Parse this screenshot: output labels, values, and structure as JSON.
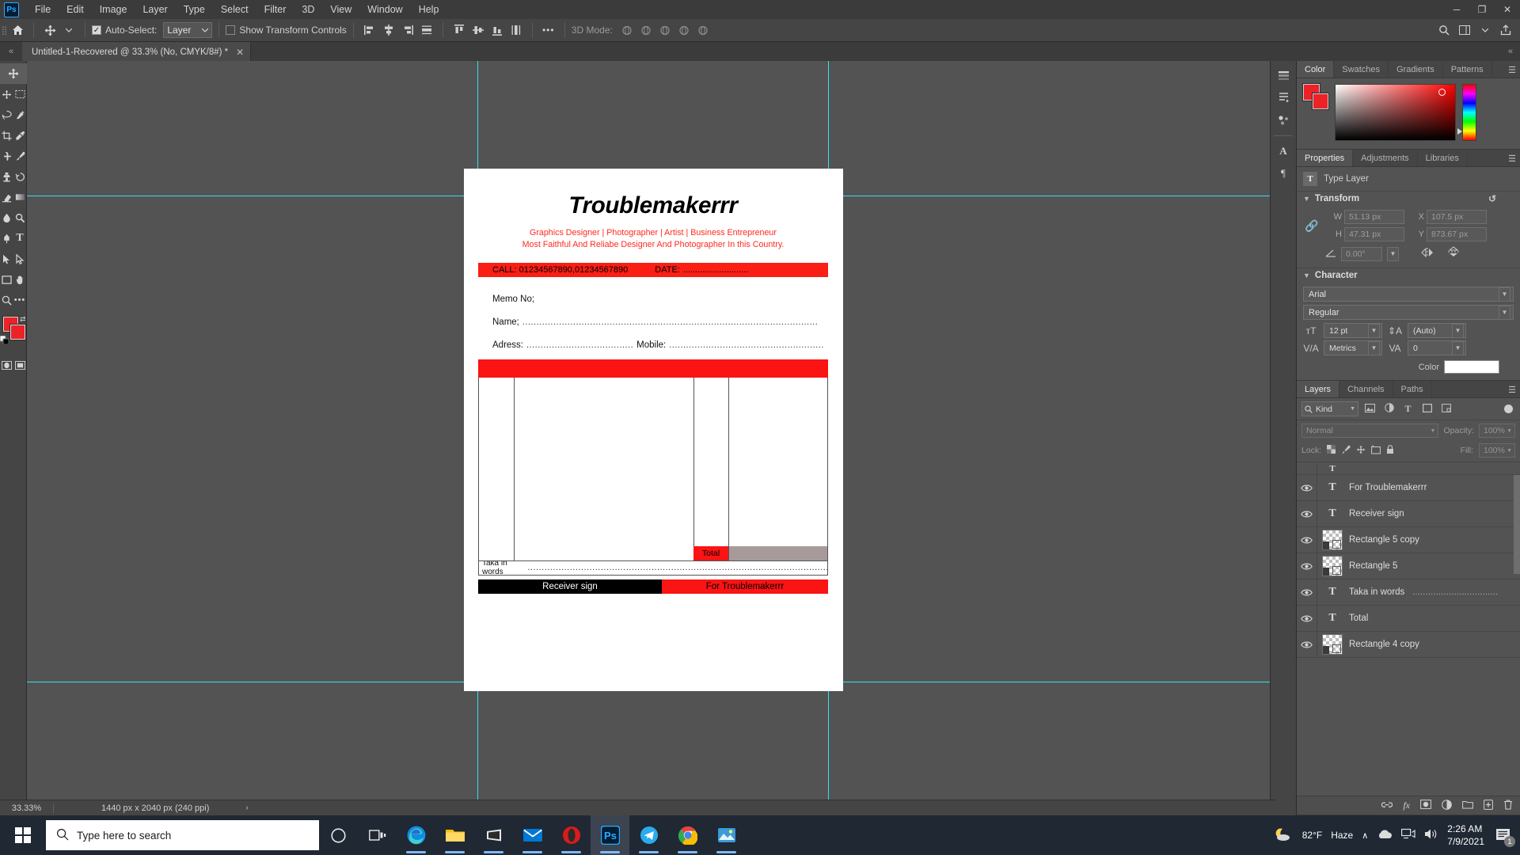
{
  "app": {
    "name": "Adobe Photoshop",
    "logo_text": "Ps"
  },
  "menubar": {
    "items": [
      "File",
      "Edit",
      "Image",
      "Layer",
      "Type",
      "Select",
      "Filter",
      "3D",
      "View",
      "Window",
      "Help"
    ],
    "window_controls": {
      "minimize": "─",
      "maximize": "❐",
      "close": "✕"
    }
  },
  "options_bar": {
    "home_icon": "home-icon",
    "move_tool_icon": "move-tool-icon",
    "auto_select_label": "Auto-Select:",
    "auto_select_checked": true,
    "layer_select_value": "Layer",
    "show_transform_label": "Show Transform Controls",
    "show_transform_checked": false,
    "more_label": "•••",
    "mode_3d_label": "3D Mode:",
    "align_icons": [
      "align-left-edges-icon",
      "align-horizontal-centers-icon",
      "align-right-edges-icon",
      "distribute-horizontally-icon",
      "align-top-edges-icon",
      "align-vertical-centers-icon",
      "align-bottom-edges-icon",
      "distribute-vertically-icon"
    ],
    "mode3d_icons": [
      "orbit-3d-icon",
      "roll-3d-icon",
      "pan-3d-icon",
      "slide-3d-icon",
      "scale-3d-icon"
    ],
    "right_icons": [
      "search-icon",
      "workspace-icon",
      "arrange-documents-icon",
      "share-icon"
    ]
  },
  "document_tab": {
    "title": "Untitled-1-Recovered @ 33.3% (No, CMYK/8#) *",
    "close": "✕",
    "dock_collapse": "«",
    "right_collapse": "«"
  },
  "toolbar": {
    "tools": [
      "move-tool",
      "rectangular-marquee-tool",
      "lasso-tool",
      "quick-selection-tool",
      "crop-tool",
      "eyedropper-tool",
      "spot-healing-brush-tool",
      "brush-tool",
      "clone-stamp-tool",
      "history-brush-tool",
      "eraser-tool",
      "gradient-tool",
      "blur-tool",
      "dodge-tool",
      "pen-tool",
      "type-tool",
      "path-selection-tool",
      "rectangle-tool",
      "hand-tool",
      "zoom-tool",
      "more-tools",
      "edit-toolbar",
      "quick-mask-tool",
      "screen-mode-tool"
    ],
    "foreground_color": "#ec2227",
    "background_color": "#ec2227",
    "swap_icon": "swap-colors-icon",
    "default_icon": "default-colors-icon"
  },
  "canvas": {
    "background": "#535353",
    "guides_color": "#32e0e8",
    "document": {
      "title": "Troublemakerrr",
      "subtitle_line1": "Graphics Designer | Photographer | Artist | Business Entrepreneur",
      "subtitle_line2": "Most Faithful And Reliabe Designer And Photographer In this Country.",
      "subtitle_color": "#ff2a1f",
      "call_bar": {
        "call_text": "CALL: 01234567890,01234567890",
        "date_label": "DATE:",
        "date_dots": "...........................",
        "background": "#fa1e14"
      },
      "memo_label": "Memo No;",
      "fields": [
        {
          "label": "Name;",
          "dots": "........................................................................................................."
        },
        {
          "label": "Adress:",
          "dots": "......................................",
          "label2": "Mobile:",
          "dots2": "......................................................."
        }
      ],
      "red_band_color": "#fa1414",
      "table": {
        "total_label": "Total",
        "total_cell_color": "#fa1414",
        "amount_cell_color": "#a69a9a"
      },
      "taka_label": "Taka in words",
      "taka_dots": "..........................................................................................................................",
      "footer": {
        "receiver_sign": "Receiver sign",
        "for_company": "For Troublemakerrr",
        "left_background": "#000000",
        "right_background": "#fa1414"
      }
    }
  },
  "right_iconbar": {
    "items": [
      "history-panel-icon",
      "actions-panel-icon",
      "brush-settings-icon",
      "adjustments-panel-icon",
      "character-panel-icon",
      "paragraph-panel-icon"
    ]
  },
  "color_panel": {
    "tabs": [
      "Color",
      "Swatches",
      "Gradients",
      "Patterns"
    ],
    "active_tab": "Color",
    "menu_icon": "panel-menu-icon",
    "foreground": "#ec2227",
    "background": "#ec2227"
  },
  "properties_panel": {
    "tabs": [
      "Properties",
      "Adjustments",
      "Libraries"
    ],
    "active_tab": "Properties",
    "menu_icon": "panel-menu-icon",
    "layer_type": "Type Layer",
    "transform": {
      "section_title": "Transform",
      "reset_icon": "reset-icon",
      "link_icon": "link-icon",
      "w_label": "W",
      "w_value": "51.13 px",
      "h_label": "H",
      "h_value": "47.31 px",
      "x_label": "X",
      "x_value": "107.5 px",
      "y_label": "Y",
      "y_value": "873.67 px",
      "angle_icon": "angle-icon",
      "angle_value": "0.00°",
      "flip_h_icon": "flip-horizontal-icon",
      "flip_v_icon": "flip-vertical-icon"
    },
    "character": {
      "section_title": "Character",
      "font_family": "Arial",
      "font_style": "Regular",
      "size_icon": "font-size-icon",
      "font_size": "12 pt",
      "leading_icon": "leading-icon",
      "leading": "(Auto)",
      "kerning_icon": "kerning-icon",
      "kerning": "Metrics",
      "tracking_icon": "tracking-icon",
      "tracking": "0",
      "color_label": "Color",
      "color_value": "#ffffff"
    }
  },
  "layers_panel": {
    "tabs": [
      "Layers",
      "Channels",
      "Paths"
    ],
    "active_tab": "Layers",
    "menu_icon": "panel-menu-icon",
    "filter": {
      "search_icon": "search-icon",
      "kind_label": "Kind",
      "icons": [
        "filter-pixel-icon",
        "filter-adjustment-icon",
        "filter-type-icon",
        "filter-shape-icon",
        "filter-smart-object-icon"
      ],
      "toggle": "filter-toggle"
    },
    "blend_mode": "Normal",
    "opacity_label": "Opacity:",
    "opacity_value": "100%",
    "fill_label": "Fill:",
    "fill_value": "100%",
    "lock_label": "Lock:",
    "lock_icons": [
      "lock-transparent-pixels-icon",
      "lock-image-pixels-icon",
      "lock-position-icon",
      "lock-artboard-icon",
      "lock-all-icon"
    ],
    "layers": [
      {
        "name": "For Troublemakerrr",
        "type": "type",
        "visible": true
      },
      {
        "name": "Receiver sign",
        "type": "type",
        "visible": true
      },
      {
        "name": "Rectangle 5 copy",
        "type": "shape",
        "visible": true
      },
      {
        "name": "Rectangle 5",
        "type": "shape",
        "visible": true
      },
      {
        "name": "Taka in words",
        "type": "type",
        "visible": true,
        "dots": "................................."
      },
      {
        "name": "Total",
        "type": "type",
        "visible": true
      },
      {
        "name": "Rectangle 4 copy",
        "type": "shape",
        "visible": true
      }
    ],
    "footer_icons": [
      "link-layers-icon",
      "layer-style-icon",
      "layer-mask-icon",
      "adjustment-layer-icon",
      "new-group-icon",
      "new-layer-icon",
      "delete-layer-icon"
    ]
  },
  "status_bar": {
    "zoom": "33.33%",
    "doc_size": "1440 px x 2040 px (240 ppi)",
    "arrow": "›"
  },
  "taskbar": {
    "search_placeholder": "Type here to search",
    "search_icon": "search-icon",
    "start_icon": "windows-start-icon",
    "items": [
      {
        "name": "cortana-icon",
        "running": false
      },
      {
        "name": "task-view-icon",
        "running": false
      },
      {
        "name": "microsoft-edge-icon",
        "running": true
      },
      {
        "name": "file-explorer-icon",
        "running": true
      },
      {
        "name": "microsoft-store-icon",
        "running": true
      },
      {
        "name": "mail-icon",
        "running": true
      },
      {
        "name": "opera-gx-icon",
        "running": true
      },
      {
        "name": "photoshop-icon",
        "running": true,
        "active": true
      },
      {
        "name": "telegram-icon",
        "running": true
      },
      {
        "name": "google-chrome-icon",
        "running": true
      },
      {
        "name": "photos-icon",
        "running": true
      }
    ],
    "tray": {
      "weather_icon": "moon-cloud-icon",
      "weather_temp": "82°F",
      "weather_cond": "Haze",
      "chevron": "∧",
      "onedrive_icon": "onedrive-icon",
      "network_icon": "network-icon",
      "volume_icon": "volume-icon",
      "time": "2:26 AM",
      "date": "7/9/2021",
      "notification_icon": "notifications-icon",
      "notification_count": "1"
    }
  }
}
